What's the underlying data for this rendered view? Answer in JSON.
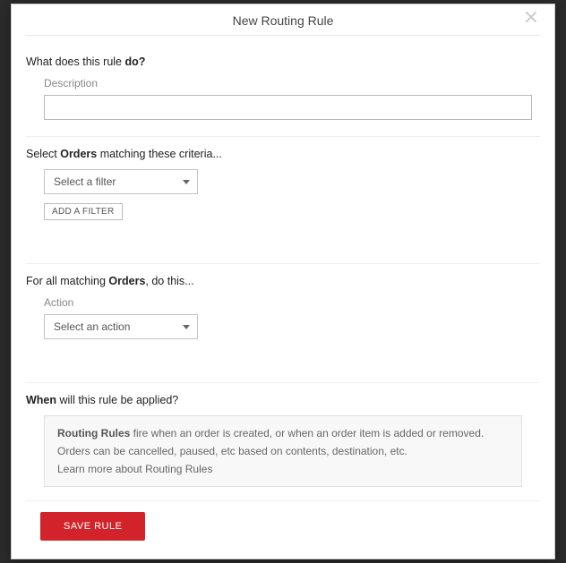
{
  "modal": {
    "title": "New Routing Rule"
  },
  "section_what": {
    "title_prefix": "What does this rule ",
    "title_bold": "do?",
    "description_label": "Description",
    "description_value": ""
  },
  "section_criteria": {
    "title_prefix": "Select ",
    "title_bold": "Orders",
    "title_suffix": " matching these criteria...",
    "filter_placeholder": "Select a filter",
    "add_filter_label": "ADD A FILTER"
  },
  "section_action": {
    "title_prefix": "For all matching ",
    "title_bold": "Orders",
    "title_suffix": ", do this...",
    "action_label": "Action",
    "action_placeholder": "Select an action"
  },
  "section_when": {
    "title_bold": "When",
    "title_suffix": " will this rule be applied?",
    "info_line1_bold": "Routing Rules",
    "info_line1_rest": " fire when an order is created, or when an order item is added or removed.",
    "info_line2": "Orders can be cancelled, paused, etc based on contents, destination, etc.",
    "info_line3": "Learn more about Routing Rules"
  },
  "footer": {
    "save_label": "SAVE RULE"
  }
}
